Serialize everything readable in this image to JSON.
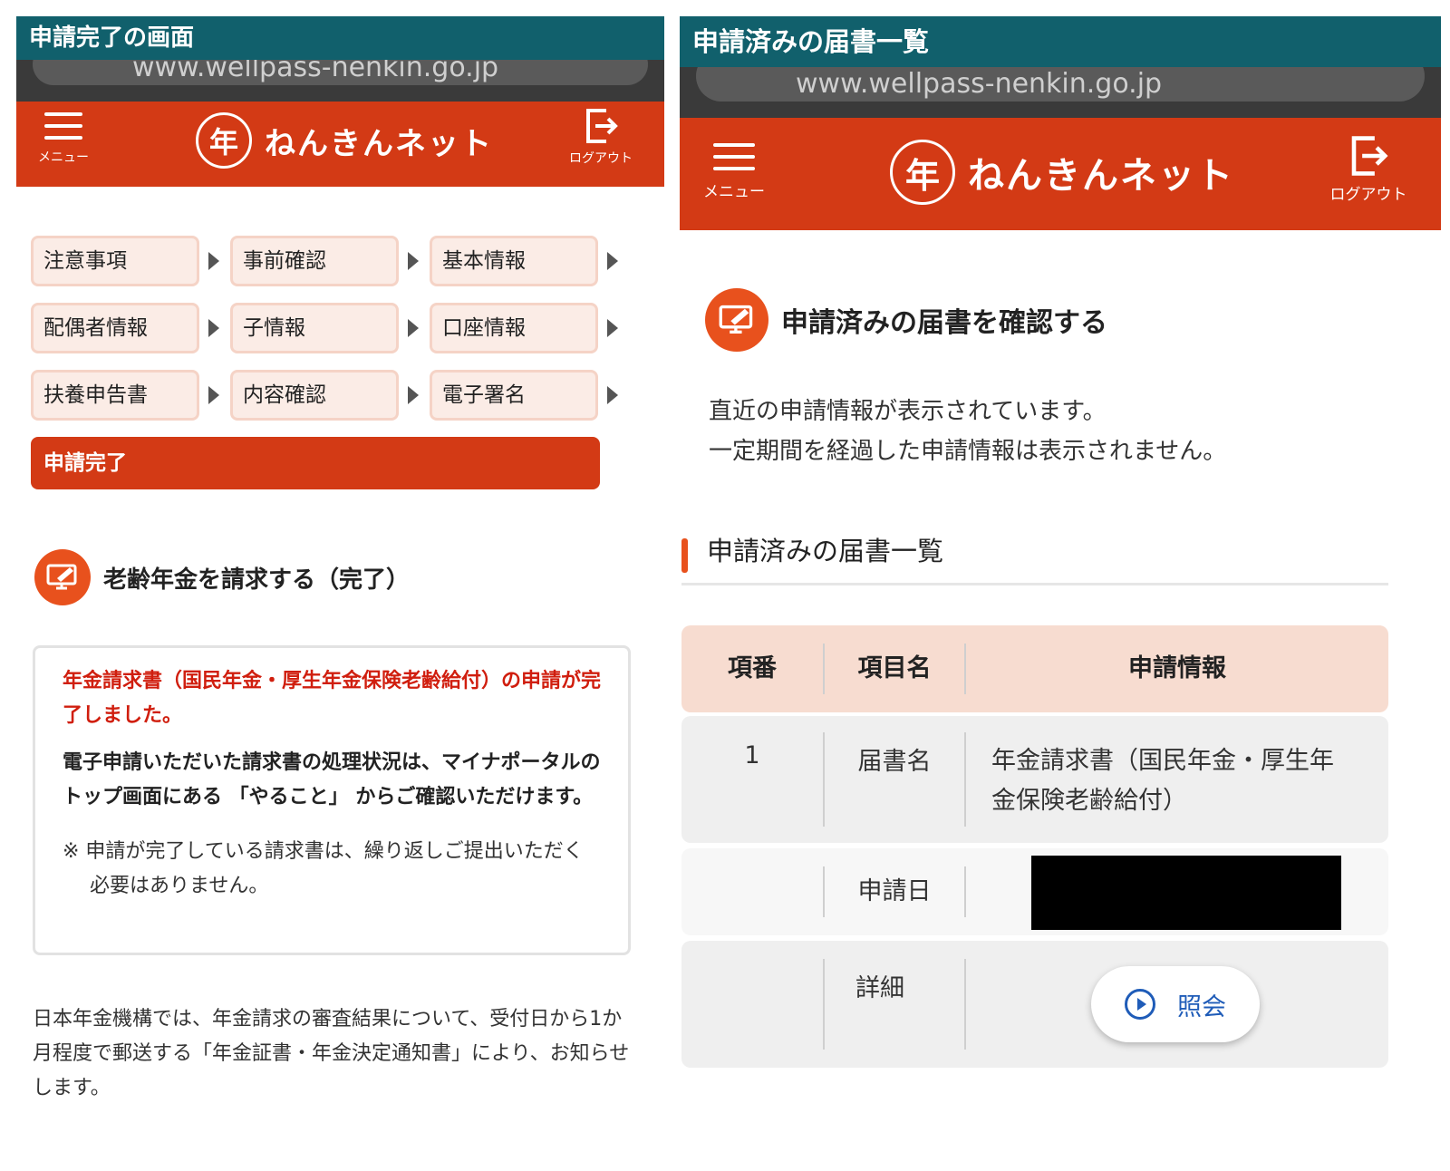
{
  "left": {
    "caption": "申請完了の画面",
    "url": "www.wellpass-nenkin.go.jp",
    "menu_label": "メニュー",
    "logout_label": "ログアウト",
    "seal_char": "年",
    "app_name": "ねんきんネット",
    "steps": [
      "注意事項",
      "事前確認",
      "基本情報",
      "配偶者情報",
      "子情報",
      "口座情報",
      "扶養申告書",
      "内容確認",
      "電子署名"
    ],
    "current_step": "申請完了",
    "section_title": "老齢年金を請求する（完了）",
    "notice_red": "年金請求書（国民年金・厚生年金保険老齢給付）の申請が完了しました。",
    "notice_bold": "電子申請いただいた請求書の処理状況は、マイナポータルのトップ画面にある 「やること」 からご確認いただけます。",
    "notice_note": "※ 申請が完了している請求書は、繰り返しご提出いただく必要はありません。",
    "footer": "日本年金機構では、年金請求の審査結果について、受付日から1か月程度で郵送する「年金証書・年金決定通知書」により、お知らせします。"
  },
  "right": {
    "caption": "申請済みの届書一覧",
    "url": "www.wellpass-nenkin.go.jp",
    "menu_label": "メニュー",
    "logout_label": "ログアウト",
    "seal_char": "年",
    "app_name": "ねんきんネット",
    "section_title": "申請済みの届書を確認する",
    "desc_line1": "直近の申請情報が表示されています。",
    "desc_line2": "一定期間を経過した申請情報は表示されません。",
    "list_heading": "申請済みの届書一覧",
    "table": {
      "headers": [
        "項番",
        "項目名",
        "申請情報"
      ],
      "row_no": "1",
      "item_form": "届書名",
      "form_value_line1": "年金請求書（国民年金・厚生年",
      "form_value_line2": "金保険老齢給付）",
      "item_date": "申請日",
      "item_detail": "詳細",
      "detail_button": "照会"
    }
  },
  "colors": {
    "brand_red": "#d33a15",
    "caption_teal": "#11606c",
    "accent_orange": "#e8511d",
    "alert_red": "#d01e0e",
    "link_blue": "#1f5cb8"
  }
}
